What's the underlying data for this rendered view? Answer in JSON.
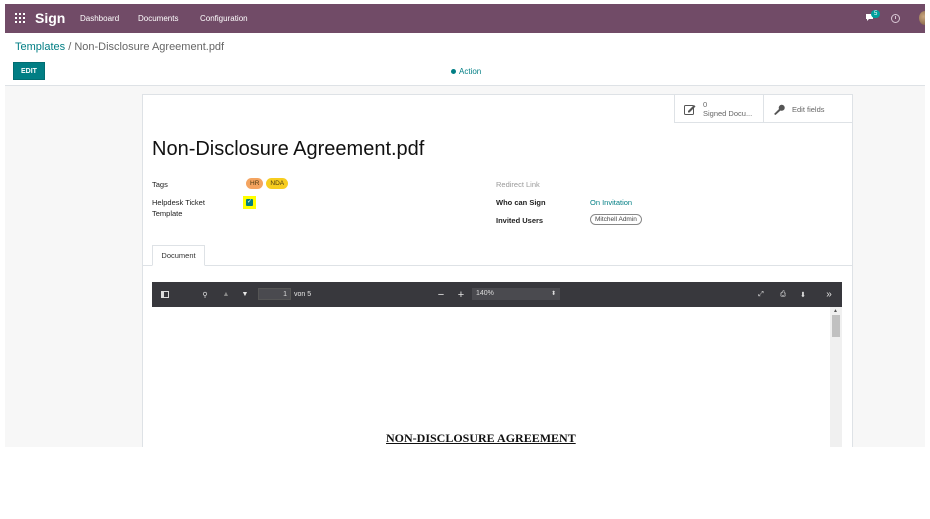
{
  "navbar": {
    "brand": "Sign",
    "menu": [
      "Dashboard",
      "Documents",
      "Configuration"
    ],
    "chat_badge": "5"
  },
  "breadcrumb": {
    "parent": "Templates",
    "separator": " / ",
    "current": "Non-Disclosure Agreement.pdf"
  },
  "controls": {
    "edit_label": "EDIT",
    "action_label": "Action"
  },
  "stat_buttons": {
    "signed_count": "0",
    "signed_label": "Signed Docu...",
    "edit_fields_label": "Edit fields"
  },
  "record": {
    "title": "Non-Disclosure Agreement.pdf",
    "tags_label": "Tags",
    "tags": [
      "HR",
      "NDA"
    ],
    "helpdesk_label": "Helpdesk Ticket Template",
    "helpdesk_checked": true,
    "redirect_label": "Redirect Link",
    "who_can_sign_label": "Who can Sign",
    "who_can_sign_value": "On Invitation",
    "invited_users_label": "Invited Users",
    "invited_users": [
      "Mitchell Admin"
    ]
  },
  "tabs": [
    "Document"
  ],
  "pdf_viewer": {
    "page_number": "1",
    "page_count": "von 5",
    "zoom": "140%",
    "document_heading": "NON-DISCLOSURE AGREEMENT"
  },
  "colors": {
    "navbar": "#714b67",
    "accent": "#017e84",
    "tag_hr": "#f4a460",
    "tag_nda": "#f7cd1f",
    "highlight": "#ffff00"
  }
}
